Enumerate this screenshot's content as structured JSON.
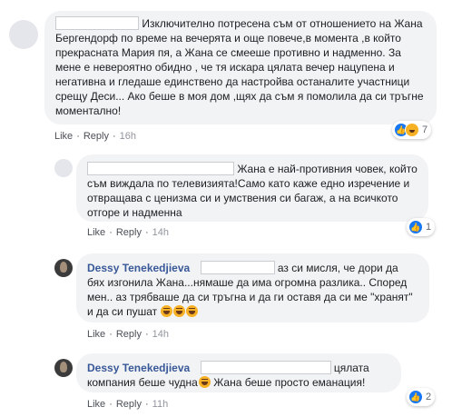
{
  "actions": {
    "like": "Like",
    "reply": "Reply",
    "separator": "·"
  },
  "comments": [
    {
      "text": "Изключително потресена съм от отношението на Жана Бергендорф по време на вечерята и още повече,в момента ,в който прекрасната Мария пя, а Жана се смееше противно и надменно. За мене е невероятно обидно , че тя искара цялата вечер нацупена и негативна и гледаше единствено да настройва останалите участници срещу Деси... Ако беше в моя дом ,щях да съм я помолила да си тръгне моментално!",
      "time": "16h",
      "reactions": {
        "count": "7",
        "icons": [
          "like-icon",
          "haha-icon"
        ]
      }
    },
    {
      "text": "Жана е най-противния човек, който съм виждала по телевизията!Само като каже едно изречение и отвращава с ценизма си и умствения си багаж, а на всичкото отгоре и надменна",
      "time": "14h",
      "reactions": {
        "count": "1",
        "icons": [
          "like-icon"
        ]
      }
    },
    {
      "author": "Dessy Tenekedjieva",
      "text": "аз си мисля, че дори да бях изгонила Жана...нямаше да има огромна разлика.. Според мен.. аз трябваше да си тръгна и да ги оставя да си ме \"хранят\" и да си пушат",
      "time": "14h",
      "emoji": "laughing-emoji"
    },
    {
      "author": "Dessy Tenekedjieva",
      "text_before": "цялата компания беше чудна",
      "text_after": " Жана беше просто еманация!",
      "time": "11h",
      "reactions": {
        "count": "2",
        "icons": [
          "like-icon"
        ]
      }
    }
  ],
  "colors": {
    "name": "#385898",
    "bubble": "#f2f3f5",
    "like": "#1877f2"
  }
}
